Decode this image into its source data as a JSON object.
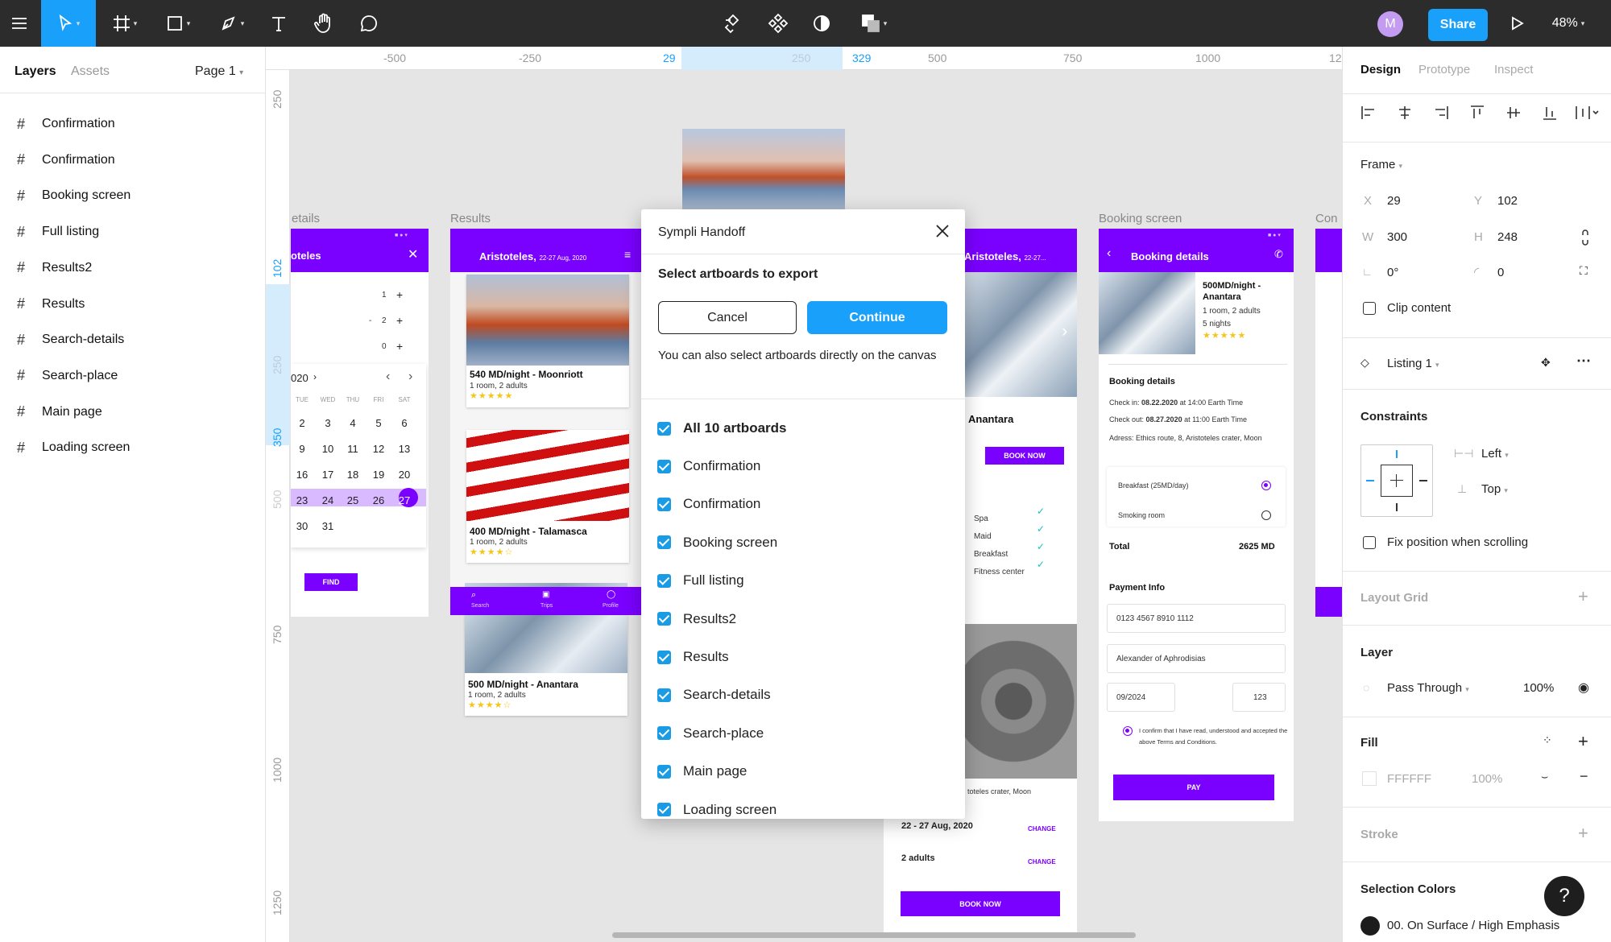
{
  "toolbar": {
    "share_label": "Share",
    "zoom": "48%",
    "avatar_initial": "M"
  },
  "left_panel": {
    "tabs": [
      "Layers",
      "Assets"
    ],
    "page": "Page 1",
    "layers": [
      "Confirmation",
      "Confirmation",
      "Booking screen",
      "Full listing",
      "Results2",
      "Results",
      "Search-details",
      "Search-place",
      "Main page",
      "Loading screen"
    ]
  },
  "ruler": {
    "top": [
      "-500",
      "-250",
      "29",
      "250",
      "329",
      "500",
      "750",
      "1000",
      "12"
    ],
    "left": [
      "250",
      "102",
      "250",
      "350",
      "500",
      "750",
      "1000",
      "1250"
    ]
  },
  "canvas": {
    "labels": {
      "search_details": "etails",
      "results": "Results",
      "booking": "Booking screen",
      "con": "Con"
    },
    "search_details": {
      "title": "oteles",
      "counters": [
        "1",
        "2",
        "0"
      ],
      "month": "020",
      "weekdays": [
        "TUE",
        "WED",
        "THU",
        "FRI",
        "SAT"
      ],
      "weeks": [
        [
          "2",
          "3",
          "4",
          "5",
          "6"
        ],
        [
          "9",
          "10",
          "11",
          "12",
          "13"
        ],
        [
          "16",
          "17",
          "18",
          "19",
          "20"
        ],
        [
          "23",
          "24",
          "25",
          "26",
          "27"
        ],
        [
          "30",
          "31"
        ]
      ],
      "find": "FIND"
    },
    "results": {
      "header": "Aristoteles,",
      "header_date": "22-27 Aug, 2020",
      "cards": [
        {
          "title": "540 MD/night - Moonriott",
          "sub": "1 room, 2 adults",
          "stars": "★★★★★"
        },
        {
          "title": "400 MD/night - Talamasca",
          "sub": "1 room, 2 adults",
          "stars": "★★★★☆"
        },
        {
          "title": "500 MD/night - Anantara",
          "sub": "1 room, 2 adults",
          "stars": "★★★★☆"
        }
      ],
      "nav": [
        "Search",
        "Trips",
        "Profile"
      ]
    },
    "listing": {
      "header": "Aristoteles,",
      "header_date": "22-27...",
      "name": "Anantara",
      "book_now": "BOOK NOW",
      "amenities": [
        "Spa",
        "Maid",
        "Breakfast",
        "Fitness center"
      ],
      "address": "toteles crater, Moon",
      "dates": "22 - 27 Aug, 2020",
      "guests": "2 adults",
      "change": "CHANGE",
      "book_now_bottom": "BOOK NOW"
    },
    "booking": {
      "header": "Booking details",
      "hotel_title": "500MD/night - Anantara",
      "hotel_sub": "1 room, 2 adults",
      "hotel_nights": "5 nights",
      "stars": "★★★★★",
      "section": "Booking details",
      "checkin_label": "Check in: ",
      "checkin_date": "08.22.2020",
      "checkin_time": " at 14:00 Earth Time",
      "checkout_label": "Check out: ",
      "checkout_date": "08.27.2020",
      "checkout_time": " at 11:00 Earth Time",
      "address": "Adress: Ethics route, 8, Aristoteles crater, Moon",
      "breakfast": "Breakfast (25MD/day)",
      "smoking": "Smoking room",
      "total_label": "Total",
      "total_value": "2625 MD",
      "payment": "Payment Info",
      "card": "0123 4567 8910 1112",
      "holder": "Alexander of Aphrodisias",
      "expiry": "09/2024",
      "cvv": "123",
      "terms": "I confirm that I have read, understood and accepted the above Terms and Conditions.",
      "pay": "PAY"
    }
  },
  "dialog": {
    "title": "Sympli Handoff",
    "subtitle": "Select artboards to export",
    "cancel": "Cancel",
    "continue": "Continue",
    "hint": "You can also select artboards directly on the canvas",
    "all": "All 10 artboards",
    "items": [
      "Confirmation",
      "Confirmation",
      "Booking screen",
      "Full listing",
      "Results2",
      "Results",
      "Search-details",
      "Search-place",
      "Main page",
      "Loading screen"
    ]
  },
  "right_panel": {
    "tabs": [
      "Design",
      "Prototype",
      "Inspect"
    ],
    "frame_label": "Frame",
    "x_label": "X",
    "x": "29",
    "y_label": "Y",
    "y": "102",
    "w_label": "W",
    "w": "300",
    "h_label": "H",
    "h": "248",
    "rotation": "0°",
    "radius": "0",
    "clip_content": "Clip content",
    "component": "Listing 1",
    "constraints": "Constraints",
    "constraint_h": "Left",
    "constraint_v": "Top",
    "fix_position": "Fix position when scrolling",
    "layout_grid": "Layout Grid",
    "layer": "Layer",
    "blend": "Pass Through",
    "opacity": "100%",
    "fill": "Fill",
    "fill_hex": "FFFFFF",
    "fill_opacity": "100%",
    "stroke": "Stroke",
    "selection_colors": "Selection Colors",
    "selection_color_name": "00. On Surface / High Emphasis",
    "help": "?"
  },
  "colors": {
    "accent": "#7a00ff",
    "figma_blue": "#18a0fb",
    "toolbar": "#2c2c2c"
  }
}
